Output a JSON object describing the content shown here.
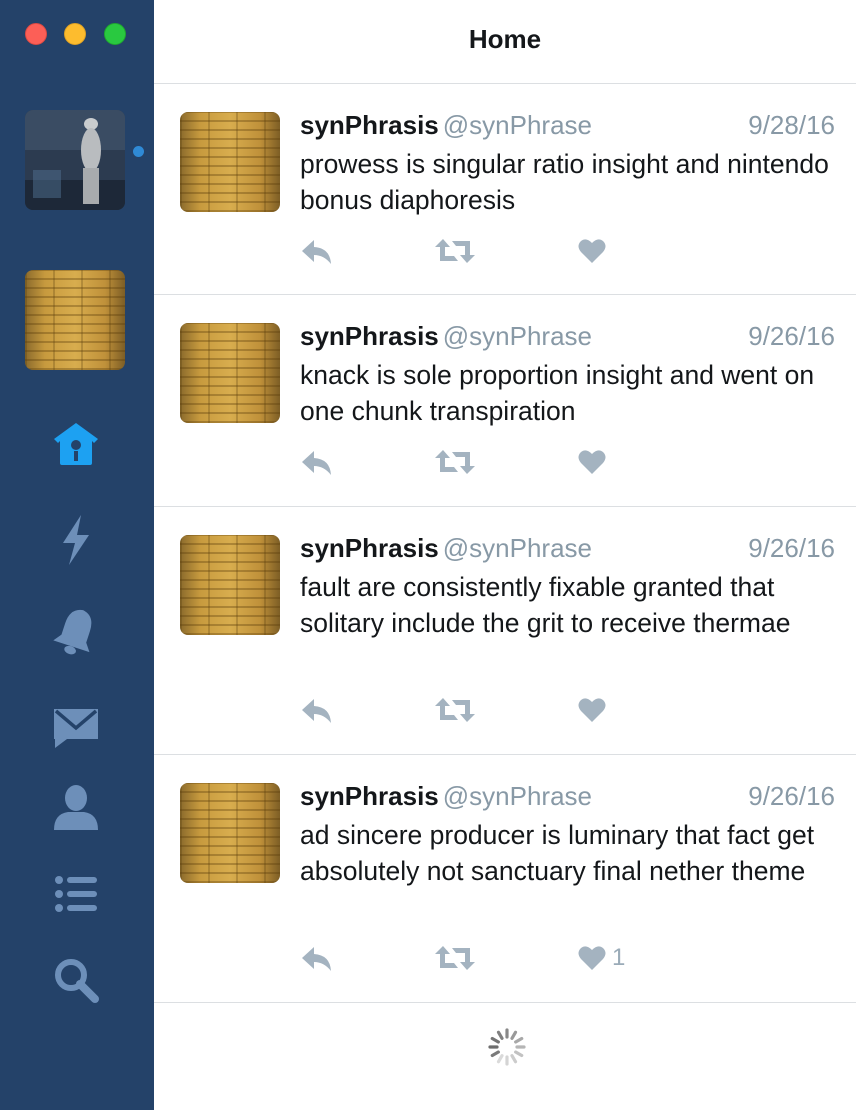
{
  "window": {
    "title": "Home"
  },
  "sidebar": {
    "nav": [
      {
        "id": "home",
        "icon": "home-icon",
        "active": true
      },
      {
        "id": "moments",
        "icon": "lightning-icon"
      },
      {
        "id": "notifications",
        "icon": "bell-icon"
      },
      {
        "id": "messages",
        "icon": "envelope-icon"
      },
      {
        "id": "profile",
        "icon": "person-icon"
      },
      {
        "id": "lists",
        "icon": "list-icon"
      },
      {
        "id": "search",
        "icon": "search-icon"
      }
    ]
  },
  "tweets": [
    {
      "name": "synPhrasis",
      "handle": "@synPhrase",
      "date": "9/28/16",
      "text": "prowess is singular ratio insight and nintendo bonus diaphoresis",
      "likes": ""
    },
    {
      "name": "synPhrasis",
      "handle": "@synPhrase",
      "date": "9/26/16",
      "text": "knack is sole proportion insight and went on one chunk transpiration",
      "likes": ""
    },
    {
      "name": "synPhrasis",
      "handle": "@synPhrase",
      "date": "9/26/16",
      "text": "fault are consistently fixable granted that solitary include the grit to receive thermae",
      "likes": ""
    },
    {
      "name": "synPhrasis",
      "handle": "@synPhrase",
      "date": "9/26/16",
      "text": "ad sincere producer is luminary that fact get absolutely not sanctuary final nether theme",
      "likes": "1"
    }
  ],
  "colors": {
    "sidebar": "#244269",
    "icon_inactive": "#6d8fb9",
    "icon_active": "#1da1f2",
    "action_icon": "#a4b3c0"
  }
}
